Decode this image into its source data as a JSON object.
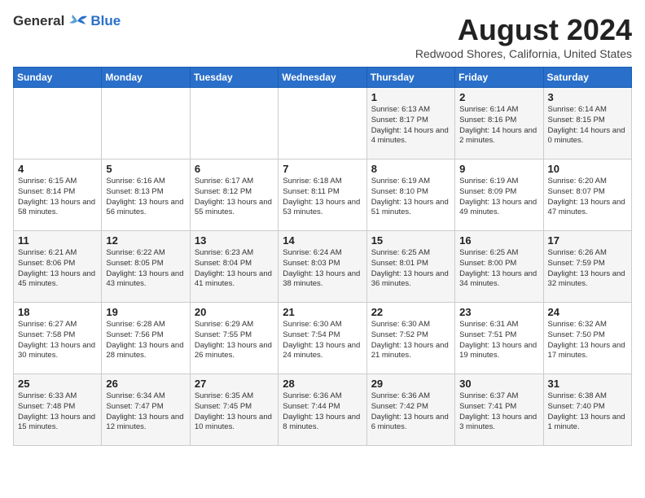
{
  "header": {
    "logo_general": "General",
    "logo_blue": "Blue",
    "month_year": "August 2024",
    "location": "Redwood Shores, California, United States"
  },
  "weekdays": [
    "Sunday",
    "Monday",
    "Tuesday",
    "Wednesday",
    "Thursday",
    "Friday",
    "Saturday"
  ],
  "weeks": [
    [
      {
        "day": "",
        "info": ""
      },
      {
        "day": "",
        "info": ""
      },
      {
        "day": "",
        "info": ""
      },
      {
        "day": "",
        "info": ""
      },
      {
        "day": "1",
        "info": "Sunrise: 6:13 AM\nSunset: 8:17 PM\nDaylight: 14 hours\nand 4 minutes."
      },
      {
        "day": "2",
        "info": "Sunrise: 6:14 AM\nSunset: 8:16 PM\nDaylight: 14 hours\nand 2 minutes."
      },
      {
        "day": "3",
        "info": "Sunrise: 6:14 AM\nSunset: 8:15 PM\nDaylight: 14 hours\nand 0 minutes."
      }
    ],
    [
      {
        "day": "4",
        "info": "Sunrise: 6:15 AM\nSunset: 8:14 PM\nDaylight: 13 hours\nand 58 minutes."
      },
      {
        "day": "5",
        "info": "Sunrise: 6:16 AM\nSunset: 8:13 PM\nDaylight: 13 hours\nand 56 minutes."
      },
      {
        "day": "6",
        "info": "Sunrise: 6:17 AM\nSunset: 8:12 PM\nDaylight: 13 hours\nand 55 minutes."
      },
      {
        "day": "7",
        "info": "Sunrise: 6:18 AM\nSunset: 8:11 PM\nDaylight: 13 hours\nand 53 minutes."
      },
      {
        "day": "8",
        "info": "Sunrise: 6:19 AM\nSunset: 8:10 PM\nDaylight: 13 hours\nand 51 minutes."
      },
      {
        "day": "9",
        "info": "Sunrise: 6:19 AM\nSunset: 8:09 PM\nDaylight: 13 hours\nand 49 minutes."
      },
      {
        "day": "10",
        "info": "Sunrise: 6:20 AM\nSunset: 8:07 PM\nDaylight: 13 hours\nand 47 minutes."
      }
    ],
    [
      {
        "day": "11",
        "info": "Sunrise: 6:21 AM\nSunset: 8:06 PM\nDaylight: 13 hours\nand 45 minutes."
      },
      {
        "day": "12",
        "info": "Sunrise: 6:22 AM\nSunset: 8:05 PM\nDaylight: 13 hours\nand 43 minutes."
      },
      {
        "day": "13",
        "info": "Sunrise: 6:23 AM\nSunset: 8:04 PM\nDaylight: 13 hours\nand 41 minutes."
      },
      {
        "day": "14",
        "info": "Sunrise: 6:24 AM\nSunset: 8:03 PM\nDaylight: 13 hours\nand 38 minutes."
      },
      {
        "day": "15",
        "info": "Sunrise: 6:25 AM\nSunset: 8:01 PM\nDaylight: 13 hours\nand 36 minutes."
      },
      {
        "day": "16",
        "info": "Sunrise: 6:25 AM\nSunset: 8:00 PM\nDaylight: 13 hours\nand 34 minutes."
      },
      {
        "day": "17",
        "info": "Sunrise: 6:26 AM\nSunset: 7:59 PM\nDaylight: 13 hours\nand 32 minutes."
      }
    ],
    [
      {
        "day": "18",
        "info": "Sunrise: 6:27 AM\nSunset: 7:58 PM\nDaylight: 13 hours\nand 30 minutes."
      },
      {
        "day": "19",
        "info": "Sunrise: 6:28 AM\nSunset: 7:56 PM\nDaylight: 13 hours\nand 28 minutes."
      },
      {
        "day": "20",
        "info": "Sunrise: 6:29 AM\nSunset: 7:55 PM\nDaylight: 13 hours\nand 26 minutes."
      },
      {
        "day": "21",
        "info": "Sunrise: 6:30 AM\nSunset: 7:54 PM\nDaylight: 13 hours\nand 24 minutes."
      },
      {
        "day": "22",
        "info": "Sunrise: 6:30 AM\nSunset: 7:52 PM\nDaylight: 13 hours\nand 21 minutes."
      },
      {
        "day": "23",
        "info": "Sunrise: 6:31 AM\nSunset: 7:51 PM\nDaylight: 13 hours\nand 19 minutes."
      },
      {
        "day": "24",
        "info": "Sunrise: 6:32 AM\nSunset: 7:50 PM\nDaylight: 13 hours\nand 17 minutes."
      }
    ],
    [
      {
        "day": "25",
        "info": "Sunrise: 6:33 AM\nSunset: 7:48 PM\nDaylight: 13 hours\nand 15 minutes."
      },
      {
        "day": "26",
        "info": "Sunrise: 6:34 AM\nSunset: 7:47 PM\nDaylight: 13 hours\nand 12 minutes."
      },
      {
        "day": "27",
        "info": "Sunrise: 6:35 AM\nSunset: 7:45 PM\nDaylight: 13 hours\nand 10 minutes."
      },
      {
        "day": "28",
        "info": "Sunrise: 6:36 AM\nSunset: 7:44 PM\nDaylight: 13 hours\nand 8 minutes."
      },
      {
        "day": "29",
        "info": "Sunrise: 6:36 AM\nSunset: 7:42 PM\nDaylight: 13 hours\nand 6 minutes."
      },
      {
        "day": "30",
        "info": "Sunrise: 6:37 AM\nSunset: 7:41 PM\nDaylight: 13 hours\nand 3 minutes."
      },
      {
        "day": "31",
        "info": "Sunrise: 6:38 AM\nSunset: 7:40 PM\nDaylight: 13 hours\nand 1 minute."
      }
    ]
  ]
}
